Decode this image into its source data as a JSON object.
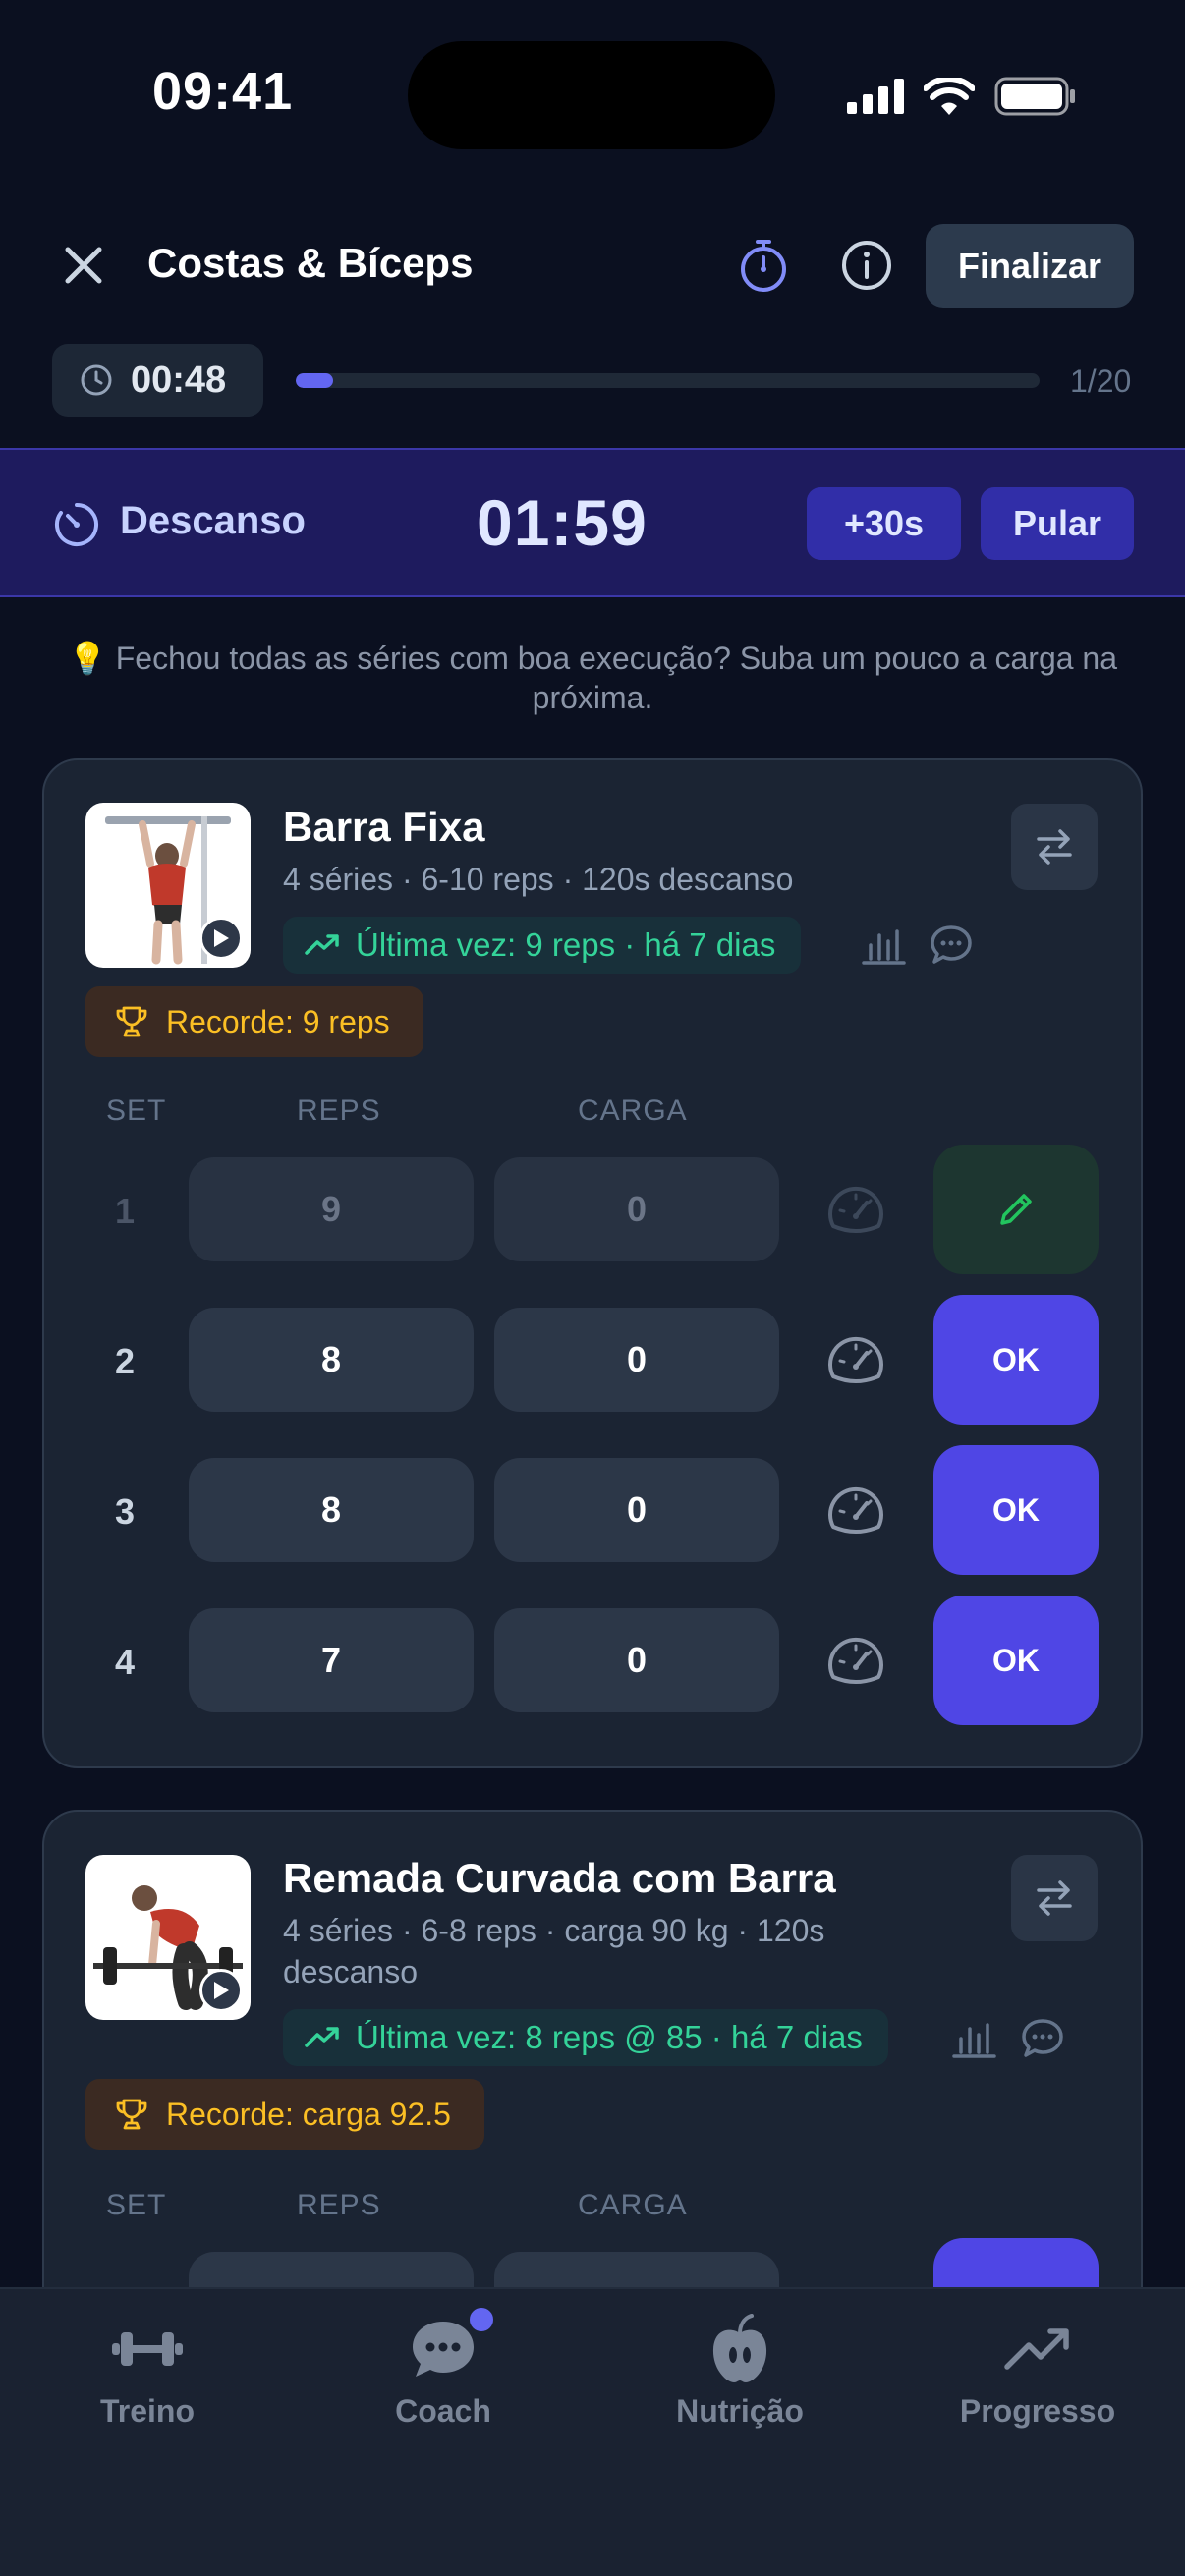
{
  "status": {
    "time": "09:41"
  },
  "header": {
    "title": "Costas & Bíceps",
    "finish_label": "Finalizar"
  },
  "session": {
    "elapsed": "00:48",
    "progress_label": "1/20",
    "progress_fraction": 0.05
  },
  "rest": {
    "label": "Descanso",
    "time": "01:59",
    "add_label": "+30s",
    "skip_label": "Pular"
  },
  "tip": {
    "icon": "lightbulb-icon",
    "text": "Fechou todas as séries com boa execução? Suba um pouco a carga na próxima."
  },
  "columns": {
    "set": "SET",
    "reps": "REPS",
    "load": "CARGA"
  },
  "exercises": [
    {
      "name": "Barra Fixa",
      "meta": "4 séries · 6-10 reps · 120s descanso",
      "last_time": "Última vez: 9 reps · há 7 dias",
      "record": "Recorde: 9 reps",
      "sets": [
        {
          "num": "1",
          "reps": "9",
          "load": "0",
          "done": true
        },
        {
          "num": "2",
          "reps": "8",
          "load": "0",
          "action": "OK"
        },
        {
          "num": "3",
          "reps": "8",
          "load": "0",
          "action": "OK"
        },
        {
          "num": "4",
          "reps": "7",
          "load": "0",
          "action": "OK"
        }
      ]
    },
    {
      "name": "Remada Curvada com Barra",
      "meta": "4 séries · 6-8 reps · carga 90 kg · 120s descanso",
      "last_time": "Última vez: 8 reps @ 85 · há 7 dias",
      "record": "Recorde: carga 92.5"
    }
  ],
  "nav": [
    {
      "label": "Treino",
      "icon": "dumbbell-icon"
    },
    {
      "label": "Coach",
      "icon": "chat-icon",
      "badge": true
    },
    {
      "label": "Nutrição",
      "icon": "apple-icon"
    },
    {
      "label": "Progresso",
      "icon": "trending-up-icon"
    }
  ],
  "colors": {
    "accent": "#4f46e5",
    "success": "#34d399",
    "record": "#fbbf24",
    "background": "#0b1020"
  }
}
